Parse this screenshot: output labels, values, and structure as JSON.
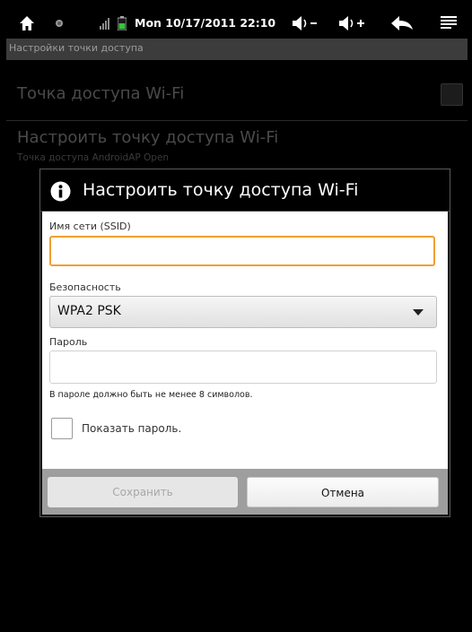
{
  "status_bar": {
    "time": "Mon 10/17/2011 22:10",
    "icons": [
      "home-icon",
      "notification-dot-icon",
      "signal-icon",
      "battery-icon",
      "volume-down-icon",
      "volume-up-icon",
      "back-icon",
      "menu-icon"
    ]
  },
  "screen_title": "Настройки точки доступа",
  "prefs": {
    "hotspot_toggle_label": "Точка доступа Wi-Fi",
    "configure_label": "Настроить точку доступа Wi-Fi",
    "configure_summary": "Точка доступа AndroidAP Open"
  },
  "dialog": {
    "title": "Настроить точку доступа Wi-Fi",
    "ssid_label": "Имя сети (SSID)",
    "ssid_value": "",
    "security_label": "Безопасность",
    "security_value": "WPA2 PSK",
    "password_label": "Пароль",
    "password_value": "",
    "password_hint": "В пароле должно быть не менее 8 символов.",
    "show_password_label": "Показать пароль.",
    "save_button": "Сохранить",
    "cancel_button": "Отмена"
  },
  "colors": {
    "focus_accent": "#f0a030",
    "title_bar": "#3c3c3c",
    "button_bar": "#9e9e9e"
  }
}
